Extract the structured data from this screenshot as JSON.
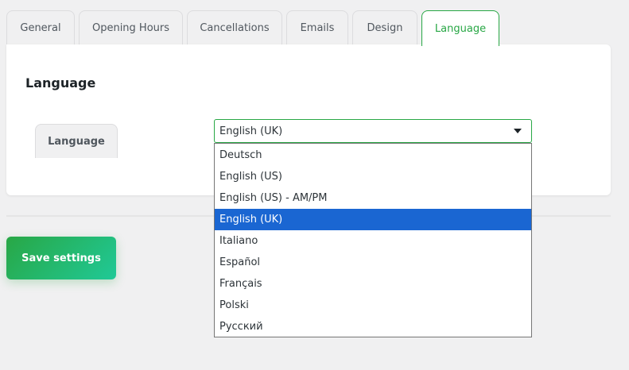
{
  "tabs": [
    {
      "label": "General"
    },
    {
      "label": "Opening Hours"
    },
    {
      "label": "Cancellations"
    },
    {
      "label": "Emails"
    },
    {
      "label": "Design"
    },
    {
      "label": "Language"
    }
  ],
  "active_tab": "Language",
  "section_title": "Language",
  "subtab_label": "Language",
  "language_select": {
    "value": "English (UK)",
    "options": [
      "Deutsch",
      "English (US)",
      "English (US) - AM/PM",
      "English (UK)",
      "Italiano",
      "Español",
      "Français",
      "Polski",
      "Русский"
    ]
  },
  "save_label": "Save settings",
  "colors": {
    "accent": "#28a745",
    "selected": "#1a66d2"
  }
}
